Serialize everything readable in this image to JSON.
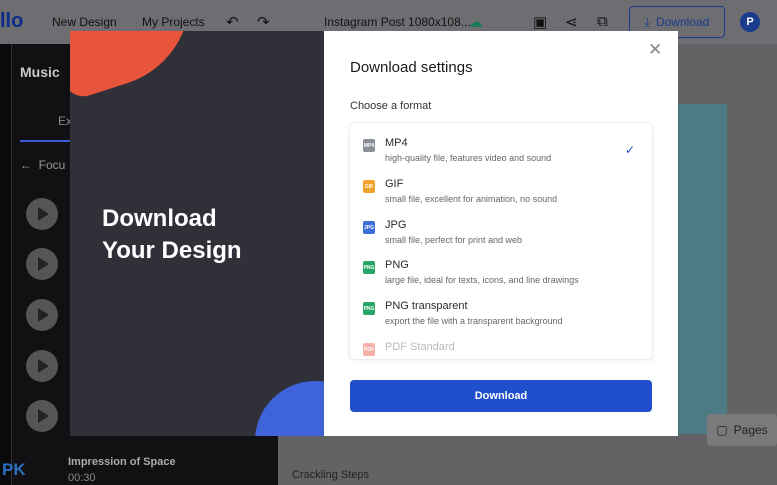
{
  "topbar": {
    "logo_text": "llo",
    "new_design": "New Design",
    "my_projects": "My Projects",
    "doc_title": "Instagram Post 1080x108...",
    "download_label": "Download",
    "avatar_letter": "P",
    "icons": [
      "undo-icon",
      "redo-icon",
      "cloud-check-icon",
      "present-icon",
      "share-icon",
      "resize-icon",
      "download-icon"
    ]
  },
  "sidebar": {
    "title": "Music",
    "tab": "Ex",
    "back_label": "Focu",
    "track_title": "Impression of Space",
    "track_time": "00:30"
  },
  "canvas": {
    "pages_label": "Pages",
    "bottom_track": "Crackling Steps"
  },
  "watermark": "PK",
  "promo": {
    "line1": "Download",
    "line2": "Your Design"
  },
  "modal": {
    "title": "Download settings",
    "subtitle": "Choose a format",
    "close_icon": "close-icon",
    "formats": [
      {
        "name": "MP4",
        "desc": "high-quality file, features video and sound",
        "badge": "MP4",
        "color": "#8a8f98",
        "selected": true
      },
      {
        "name": "GIF",
        "desc": "small file, excellent for animation, no sound",
        "badge": "GIF",
        "color": "#f0a32a",
        "selected": false
      },
      {
        "name": "JPG",
        "desc": "small file, perfect for print and web",
        "badge": "JPG",
        "color": "#3d6fd8",
        "selected": false
      },
      {
        "name": "PNG",
        "desc": "large file, ideal for texts, icons, and line drawings",
        "badge": "PNG",
        "color": "#27a567",
        "selected": false
      },
      {
        "name": "PNG transparent",
        "desc": "export the file with a transparent background",
        "badge": "PNG",
        "color": "#27a567",
        "selected": false
      },
      {
        "name": "PDF Standard",
        "desc": "",
        "badge": "PDF",
        "color": "#e5533d",
        "selected": false
      }
    ],
    "download_button": "Download"
  },
  "colors": {
    "accent": "#1f4fcc",
    "promo_bg": "#2f3038",
    "promo_orange": "#e8553a",
    "promo_blue": "#3f63d9"
  }
}
